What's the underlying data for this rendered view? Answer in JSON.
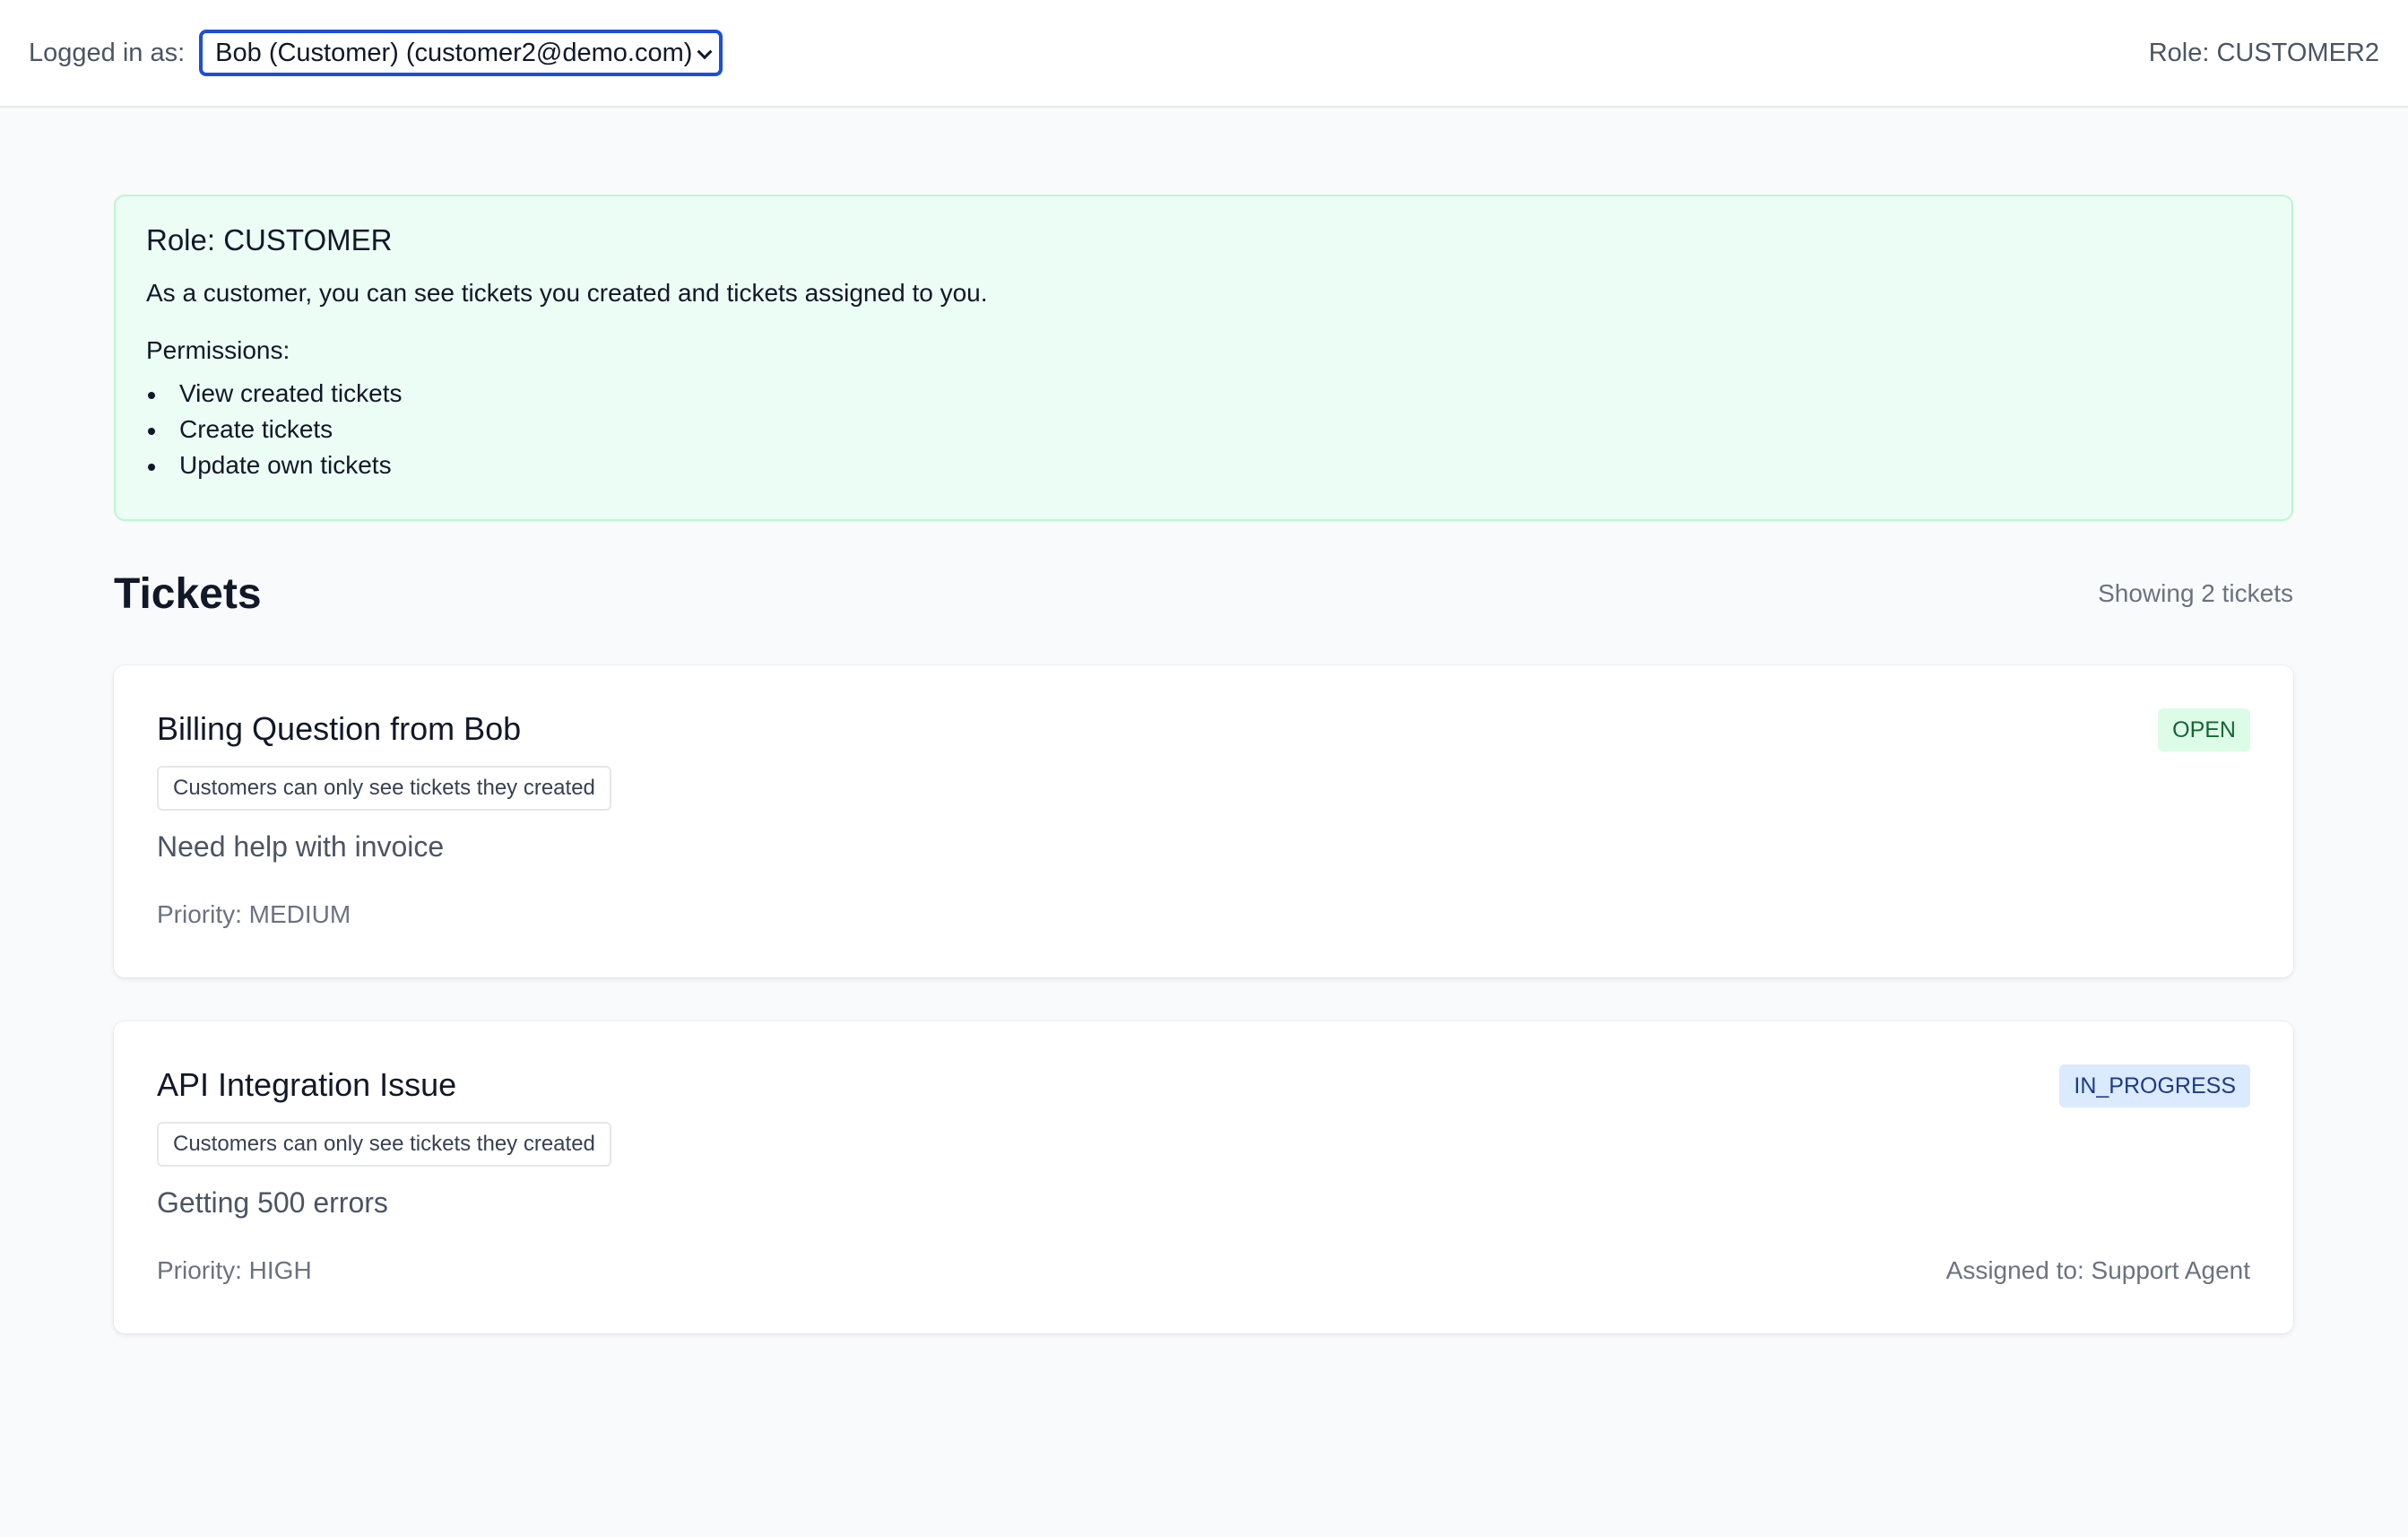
{
  "header": {
    "login_label": "Logged in as:",
    "user_select_value": "Bob (Customer) (customer2@demo.com)",
    "role_label": "Role: CUSTOMER2"
  },
  "role_card": {
    "title": "Role: CUSTOMER",
    "description": "As a customer, you can see tickets you created and tickets assigned to you.",
    "permissions_label": "Permissions:",
    "permissions": [
      "View created tickets",
      "Create tickets",
      "Update own tickets"
    ]
  },
  "tickets_section": {
    "title": "Tickets",
    "count_text": "Showing 2 tickets"
  },
  "tickets": [
    {
      "title": "Billing Question from Bob",
      "visibility_note": "Customers can only see tickets they created",
      "description": "Need help with invoice",
      "priority": "Priority: MEDIUM",
      "assigned": "",
      "status": "OPEN"
    },
    {
      "title": "API Integration Issue",
      "visibility_note": "Customers can only see tickets they created",
      "description": "Getting 500 errors",
      "priority": "Priority: HIGH",
      "assigned": "Assigned to: Support Agent",
      "status": "IN_PROGRESS"
    }
  ],
  "colors": {
    "accent": "#1d4ed8",
    "role_card_bg": "#ecfdf5",
    "status_open_bg": "#dcfce7",
    "status_in_progress_bg": "#dbeafe"
  },
  "icons": {
    "select_arrow": "chevron-down-icon"
  }
}
